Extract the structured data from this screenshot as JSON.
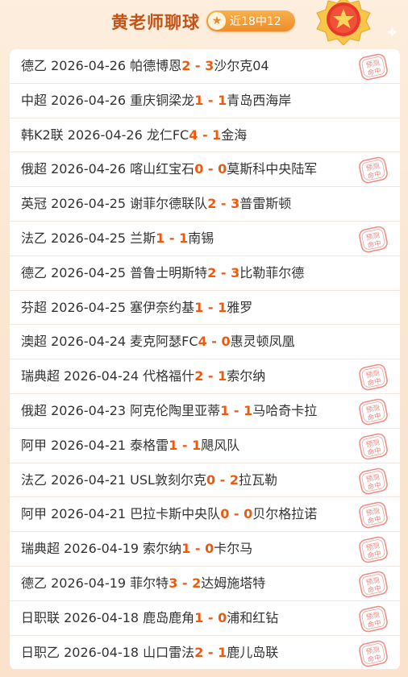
{
  "header": {
    "title": "黄老师聊球",
    "record_badge": "近18中12",
    "star_icon": "★"
  },
  "stamp": {
    "line1": "预测",
    "line2": "命中",
    "color": "#e85a4f"
  },
  "colors": {
    "score": "#ee5a0d",
    "title": "#c2541a",
    "badge": "#ef922c"
  },
  "matches": [
    {
      "league": "德乙",
      "date": "2026-04-26",
      "home": "帕德博恩",
      "home_score": "2",
      "away_score": "3",
      "away": "沙尔克04",
      "hit": true
    },
    {
      "league": "中超",
      "date": "2026-04-26",
      "home": "重庆铜梁龙",
      "home_score": "1",
      "away_score": "1",
      "away": "青岛西海岸",
      "hit": false
    },
    {
      "league": "韩K2联",
      "date": "2026-04-26",
      "home": "龙仁FC",
      "home_score": "4",
      "away_score": "1",
      "away": "金海",
      "hit": false
    },
    {
      "league": "俄超",
      "date": "2026-04-26",
      "home": "喀山红宝石",
      "home_score": "0",
      "away_score": "0",
      "away": "莫斯科中央陆军",
      "hit": true
    },
    {
      "league": "英冠",
      "date": "2026-04-25",
      "home": "谢菲尔德联队",
      "home_score": "2",
      "away_score": "3",
      "away": "普雷斯顿",
      "hit": false
    },
    {
      "league": "法乙",
      "date": "2026-04-25",
      "home": "兰斯",
      "home_score": "1",
      "away_score": "1",
      "away": "南锡",
      "hit": true
    },
    {
      "league": "德乙",
      "date": "2026-04-25",
      "home": "普鲁士明斯特",
      "home_score": "2",
      "away_score": "3",
      "away": "比勒菲尔德",
      "hit": false
    },
    {
      "league": "芬超",
      "date": "2026-04-25",
      "home": "塞伊奈约基",
      "home_score": "1",
      "away_score": "1",
      "away": "雅罗",
      "hit": false
    },
    {
      "league": "澳超",
      "date": "2026-04-24",
      "home": "麦克阿瑟FC",
      "home_score": "4",
      "away_score": "0",
      "away": "惠灵顿凤凰",
      "hit": false
    },
    {
      "league": "瑞典超",
      "date": "2026-04-24",
      "home": "代格福什",
      "home_score": "2",
      "away_score": "1",
      "away": "索尔纳",
      "hit": true
    },
    {
      "league": "俄超",
      "date": "2026-04-23",
      "home": "阿克伦陶里亚蒂",
      "home_score": "1",
      "away_score": "1",
      "away": "马哈奇卡拉",
      "hit": true
    },
    {
      "league": "阿甲",
      "date": "2026-04-21",
      "home": "泰格雷",
      "home_score": "1",
      "away_score": "1",
      "away": "飓风队",
      "hit": true
    },
    {
      "league": "法乙",
      "date": "2026-04-21",
      "home": "USL敦刻尔克",
      "home_score": "0",
      "away_score": "2",
      "away": "拉瓦勒",
      "hit": true
    },
    {
      "league": "阿甲",
      "date": "2026-04-21",
      "home": "巴拉卡斯中央队",
      "home_score": "0",
      "away_score": "0",
      "away": "贝尔格拉诺",
      "hit": true
    },
    {
      "league": "瑞典超",
      "date": "2026-04-19",
      "home": "索尔纳",
      "home_score": "1",
      "away_score": "0",
      "away": "卡尔马",
      "hit": true
    },
    {
      "league": "德乙",
      "date": "2026-04-19",
      "home": "菲尔特",
      "home_score": "3",
      "away_score": "2",
      "away": "达姆施塔特",
      "hit": true
    },
    {
      "league": "日职联",
      "date": "2026-04-18",
      "home": "鹿岛鹿角",
      "home_score": "1",
      "away_score": "0",
      "away": "浦和红钻",
      "hit": true
    },
    {
      "league": "日职乙",
      "date": "2026-04-18",
      "home": "山口雷法",
      "home_score": "2",
      "away_score": "1",
      "away": "鹿儿岛联",
      "hit": true
    }
  ]
}
